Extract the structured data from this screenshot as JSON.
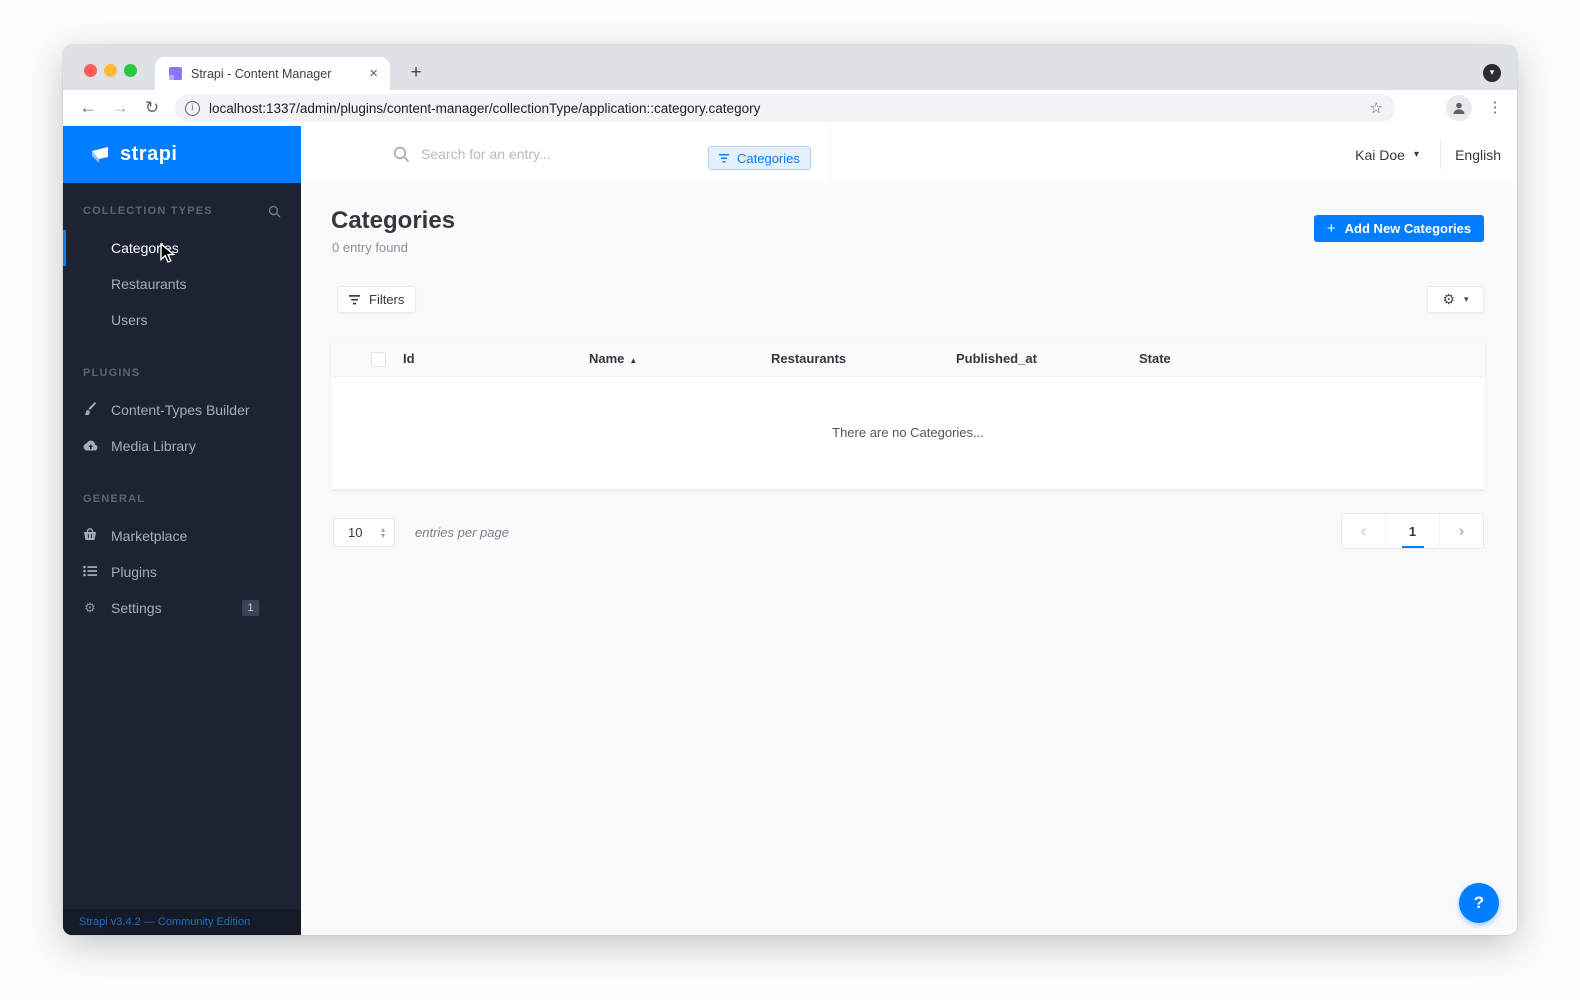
{
  "colors": {
    "brand_blue": "#007eff",
    "sidebar_bg": "#1c2433",
    "favicon_purple": "#8c75f7"
  },
  "icons": {
    "close": "×",
    "plus": "+",
    "caret_down": "▾",
    "sort_asc": "▲",
    "chevron_left": "‹",
    "chevron_right": "›",
    "stepper_up": "▴",
    "stepper_down": "▾",
    "star": "☆",
    "overflow_menu": "⋮",
    "back_arrow": "←",
    "forward_arrow": "→",
    "reload": "↻",
    "gear": "⚙",
    "info": "i",
    "tab_search_chevron": "▾"
  },
  "browser": {
    "tab_title": "Strapi - Content Manager",
    "url": "localhost:1337/admin/plugins/content-manager/collectionType/application::category.category"
  },
  "header": {
    "search_placeholder": "Search for an entry...",
    "filter_chip": "Categories",
    "user": "Kai Doe",
    "language": "English"
  },
  "sidebar": {
    "logo": "strapi",
    "collection_types": {
      "title": "COLLECTION TYPES",
      "items": [
        "Categories",
        "Restaurants",
        "Users"
      ]
    },
    "plugins_section": {
      "title": "PLUGINS",
      "items": [
        "Content-Types Builder",
        "Media Library"
      ]
    },
    "general": {
      "title": "GENERAL",
      "items": [
        "Marketplace",
        "Plugins",
        "Settings"
      ],
      "settings_badge": "1"
    },
    "footer": "Strapi v3.4.2 — Community Edition"
  },
  "content": {
    "title": "Categories",
    "subtitle": "0 entry found",
    "add_button": "Add New Categories",
    "filters_button": "Filters",
    "table": {
      "columns": [
        "Id",
        "Name",
        "Restaurants",
        "Published_at",
        "State"
      ],
      "sorted_column": "Name",
      "empty": "There are no Categories...",
      "rows": []
    },
    "pagination": {
      "per_page": "10",
      "per_page_label": "entries per page",
      "page": "1"
    }
  },
  "help": {
    "label": "?"
  }
}
